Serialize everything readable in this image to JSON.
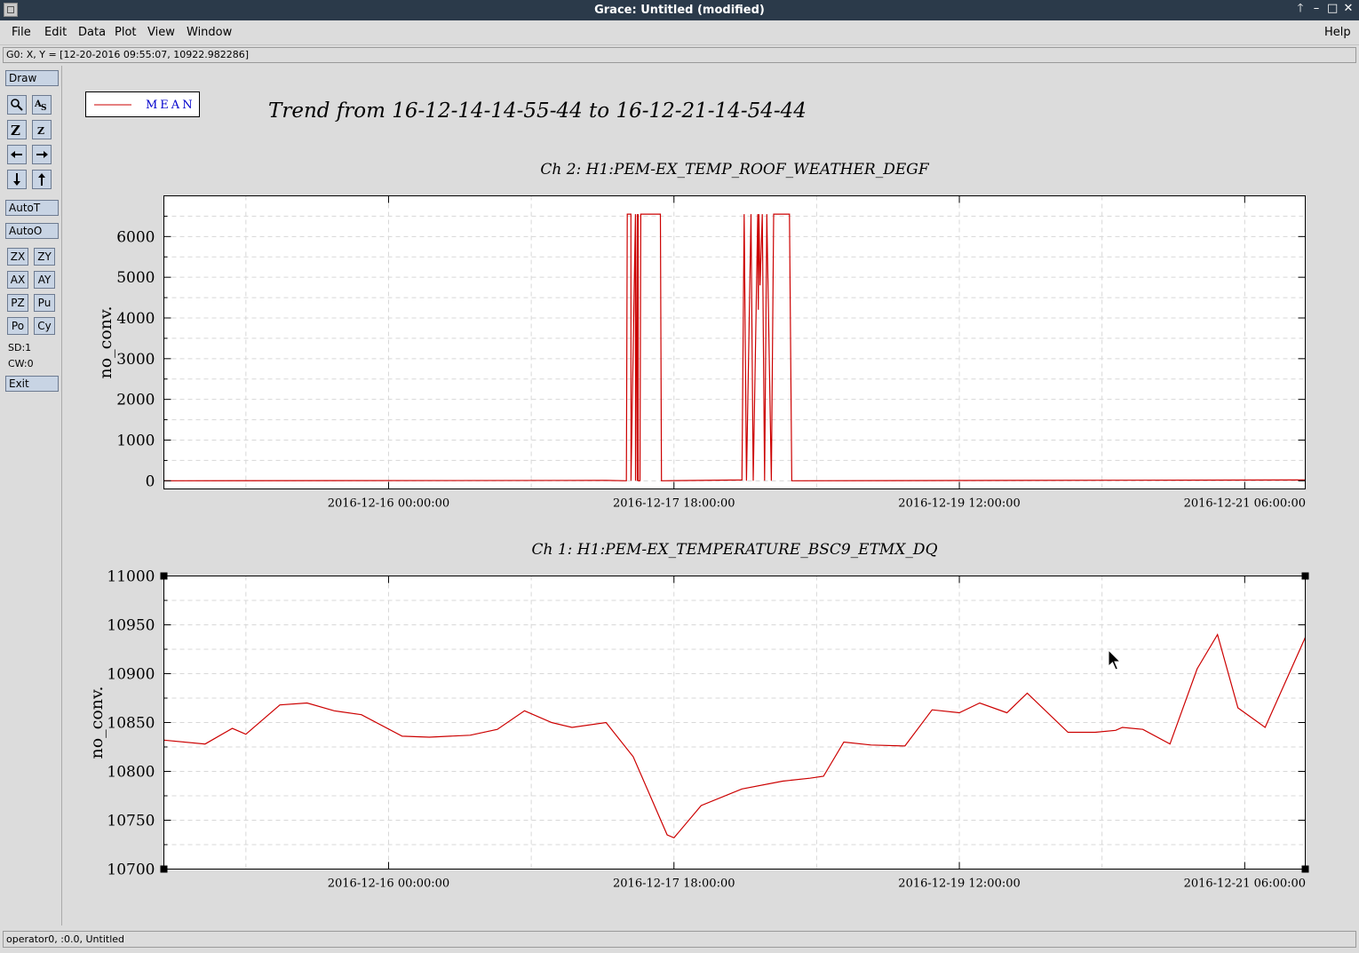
{
  "window": {
    "title": "Grace: Untitled (modified)",
    "controls": [
      "🡑",
      "–",
      "□",
      "✕"
    ]
  },
  "menubar": {
    "items": [
      "File",
      "Edit",
      "Data",
      "Plot",
      "View",
      "Window"
    ],
    "help": "Help"
  },
  "status": {
    "locator": "G0: X, Y = [12-20-2016 09:55:07, 10922.982286]",
    "bottom": "operator0, :0.0, Untitled"
  },
  "toolbar": {
    "draw": "Draw",
    "autot": "AutoT",
    "autoo": "AutoO",
    "zx": "ZX",
    "zy": "ZY",
    "ax": "AX",
    "ay": "AY",
    "pz": "PZ",
    "pu": "Pu",
    "po": "Po",
    "cy": "Cy",
    "sd": "SD:1",
    "cw": "CW:0",
    "exit": "Exit"
  },
  "legend": {
    "label": "MEAN",
    "color": "#cc0000"
  },
  "main_title": "Trend from 16-12-14-14-55-44 to 16-12-21-14-54-44",
  "chart_data": [
    {
      "type": "line",
      "title": "Ch 2: H1:PEM-EX_TEMP_ROOF_WEATHER_DEGF",
      "ylabel": "no_conv.",
      "xlabel": "",
      "x_ticks": [
        "2016-12-16 00:00:00",
        "2016-12-17 18:00:00",
        "2016-12-19 12:00:00",
        "2016-12-21 06:00:00"
      ],
      "xlim": [
        "2016-12-14 14:55:44",
        "2016-12-21 14:54:44"
      ],
      "ylim": [
        -200,
        7000
      ],
      "y_ticks": [
        0,
        1000,
        2000,
        3000,
        4000,
        5000,
        6000
      ],
      "grid": true,
      "color": "#cc0000",
      "series": [
        {
          "x": [
            "2016-12-14 14:55:44",
            "2016-12-17 08:00:00",
            "2016-12-17 11:00:00",
            "2016-12-17 11:08:00",
            "2016-12-17 11:15:00",
            "2016-12-17 11:40:00",
            "2016-12-17 11:40:30",
            "2016-12-17 12:20:00",
            "2016-12-17 12:20:30",
            "2016-12-17 12:36:00",
            "2016-12-17 12:36:30",
            "2016-12-17 12:44:00",
            "2016-12-17 12:44:30",
            "2016-12-17 13:00:00",
            "2016-12-17 13:07:00",
            "2016-12-17 13:15:00",
            "2016-12-17 16:00:00",
            "2016-12-17 16:10:00",
            "2016-12-18 04:00:00",
            "2016-12-18 04:20:00",
            "2016-12-18 04:40:00",
            "2016-12-18 05:20:00",
            "2016-12-18 05:40:00",
            "2016-12-18 06:20:00",
            "2016-12-18 06:25:00",
            "2016-12-18 06:30:00",
            "2016-12-18 06:40:00",
            "2016-12-18 07:00:00",
            "2016-12-18 07:20:00",
            "2016-12-18 07:40:00",
            "2016-12-18 08:20:00",
            "2016-12-18 08:40:00",
            "2016-12-18 09:20:00",
            "2016-12-18 10:00:00",
            "2016-12-18 11:00:00",
            "2016-12-18 11:20:00",
            "2016-12-21 14:54:44"
          ],
          "y": [
            0,
            10,
            0,
            6550,
            6550,
            6550,
            0,
            6550,
            0,
            6550,
            0,
            6550,
            0,
            0,
            6550,
            6550,
            6550,
            0,
            20,
            6550,
            0,
            6550,
            0,
            6550,
            4200,
            6550,
            4800,
            6550,
            0,
            6550,
            0,
            6550,
            6550,
            6550,
            6550,
            0,
            20
          ]
        }
      ]
    },
    {
      "type": "line",
      "title": "Ch 1: H1:PEM-EX_TEMPERATURE_BSC9_ETMX_DQ",
      "ylabel": "no_conv.",
      "xlabel": "",
      "x_ticks": [
        "2016-12-16 00:00:00",
        "2016-12-17 18:00:00",
        "2016-12-19 12:00:00",
        "2016-12-21 06:00:00"
      ],
      "xlim": [
        "2016-12-14 14:55:44",
        "2016-12-21 14:54:44"
      ],
      "ylim": [
        10700,
        11000
      ],
      "y_ticks": [
        10700,
        10750,
        10800,
        10850,
        10900,
        10950,
        11000
      ],
      "grid": true,
      "color": "#cc0000",
      "series": [
        {
          "x": [
            "2016-12-14 14:55:44",
            "2016-12-14 21:00:00",
            "2016-12-15 01:00:00",
            "2016-12-15 03:00:00",
            "2016-12-15 08:00:00",
            "2016-12-15 12:00:00",
            "2016-12-15 16:00:00",
            "2016-12-15 20:00:00",
            "2016-12-16 02:00:00",
            "2016-12-16 06:00:00",
            "2016-12-16 12:00:00",
            "2016-12-16 16:00:00",
            "2016-12-16 20:00:00",
            "2016-12-17 00:00:00",
            "2016-12-17 03:00:00",
            "2016-12-17 08:00:00",
            "2016-12-17 12:00:00",
            "2016-12-17 17:00:00",
            "2016-12-17 18:00:00",
            "2016-12-17 22:00:00",
            "2016-12-18 04:00:00",
            "2016-12-18 10:00:00",
            "2016-12-18 14:00:00",
            "2016-12-18 16:00:00",
            "2016-12-18 19:00:00",
            "2016-12-18 23:00:00",
            "2016-12-19 04:00:00",
            "2016-12-19 08:00:00",
            "2016-12-19 12:00:00",
            "2016-12-19 15:00:00",
            "2016-12-19 19:00:00",
            "2016-12-19 22:00:00",
            "2016-12-20 04:00:00",
            "2016-12-20 08:00:00",
            "2016-12-20 11:00:00",
            "2016-12-20 12:00:00",
            "2016-12-20 15:00:00",
            "2016-12-20 19:00:00",
            "2016-12-20 23:00:00",
            "2016-12-21 02:00:00",
            "2016-12-21 05:00:00",
            "2016-12-21 09:00:00",
            "2016-12-21 14:54:44"
          ],
          "y": [
            10832,
            10828,
            10844,
            10838,
            10868,
            10870,
            10862,
            10858,
            10836,
            10835,
            10837,
            10843,
            10862,
            10850,
            10845,
            10850,
            10815,
            10735,
            10732,
            10765,
            10782,
            10790,
            10793,
            10795,
            10830,
            10827,
            10826,
            10863,
            10860,
            10870,
            10860,
            10880,
            10840,
            10840,
            10842,
            10845,
            10843,
            10828,
            10905,
            10940,
            10865,
            10845,
            10937
          ]
        }
      ]
    }
  ]
}
